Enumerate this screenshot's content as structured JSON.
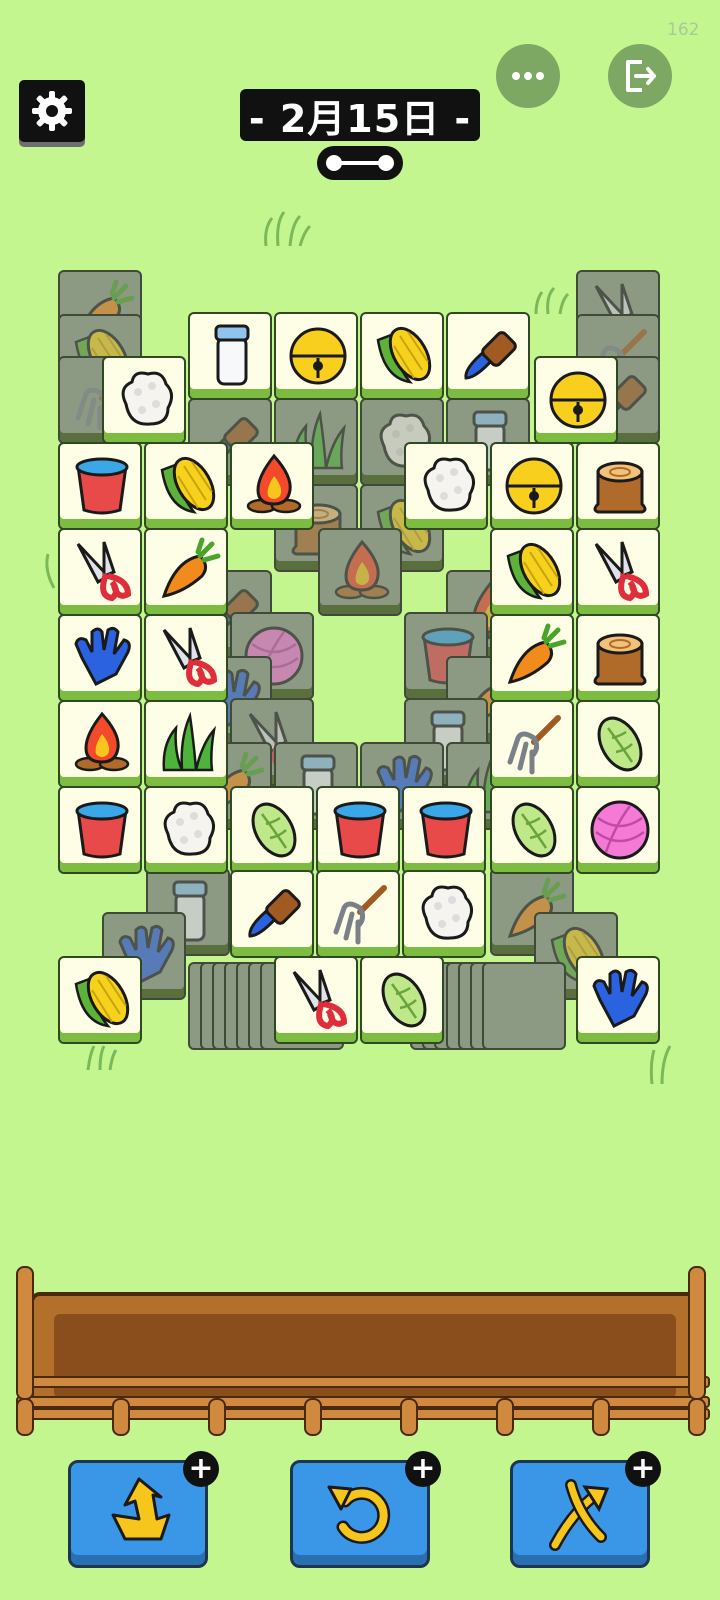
{
  "status": {
    "counter": "162"
  },
  "header": {
    "settings_icon": "gear-icon",
    "more_icon": "more-dots-icon",
    "exit_icon": "exit-icon",
    "date": "- 2月15日 -",
    "progress_icon": "bone-progress-icon"
  },
  "board": {
    "tiles_free": [
      "milk-jar",
      "bell",
      "corn",
      "brush",
      "rice",
      "bell",
      "bucket",
      "corn",
      "campfire",
      "rice",
      "bell",
      "stump",
      "shears",
      "carrot",
      "corn",
      "shears",
      "glove",
      "shears",
      "carrot",
      "stump",
      "campfire",
      "grass",
      "fork",
      "cabbage",
      "bucket",
      "rice",
      "cabbage",
      "bucket",
      "bucket",
      "cabbage",
      "yarn",
      "brush",
      "fork",
      "rice",
      "corn",
      "shears",
      "cabbage",
      "glove"
    ],
    "deck_count_label": ""
  },
  "tray": {
    "slots": 7
  },
  "tools": [
    {
      "name": "undo-return-tool",
      "icon": "return-arrow-icon"
    },
    {
      "name": "undo-tool",
      "icon": "undo-icon"
    },
    {
      "name": "shuffle-tool",
      "icon": "shuffle-icon"
    }
  ],
  "colors": {
    "background": "#c4f68f",
    "tile_face": "#fdfee5",
    "tile_base": "#7bbc41",
    "tool_blue": "#3a97e8",
    "wood": "#b2702b"
  }
}
